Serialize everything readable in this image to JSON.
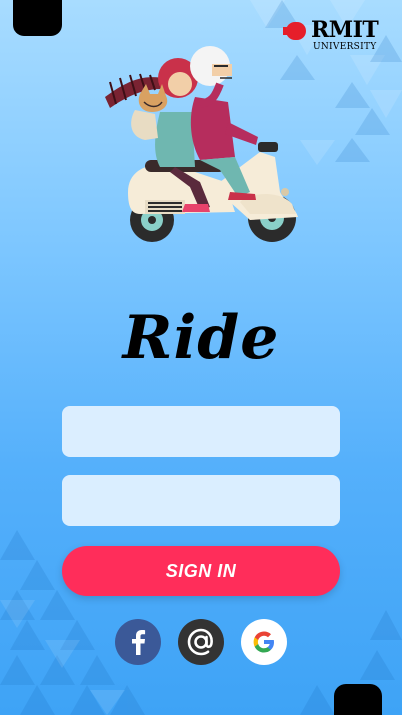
{
  "brand": {
    "logo_name": "RMIT",
    "logo_subtitle": "UNIVERSITY",
    "logo_color": "#e61e2a"
  },
  "app": {
    "title": "Ride"
  },
  "login": {
    "username_placeholder": "",
    "password_placeholder": "",
    "signin_label": "SIGN IN",
    "signin_color": "#ff2d5a"
  },
  "social": {
    "facebook_icon": "facebook-icon",
    "email_icon": "at-sign-icon",
    "google_icon": "google-icon",
    "facebook_color": "#3b5998",
    "email_color": "#333333"
  }
}
